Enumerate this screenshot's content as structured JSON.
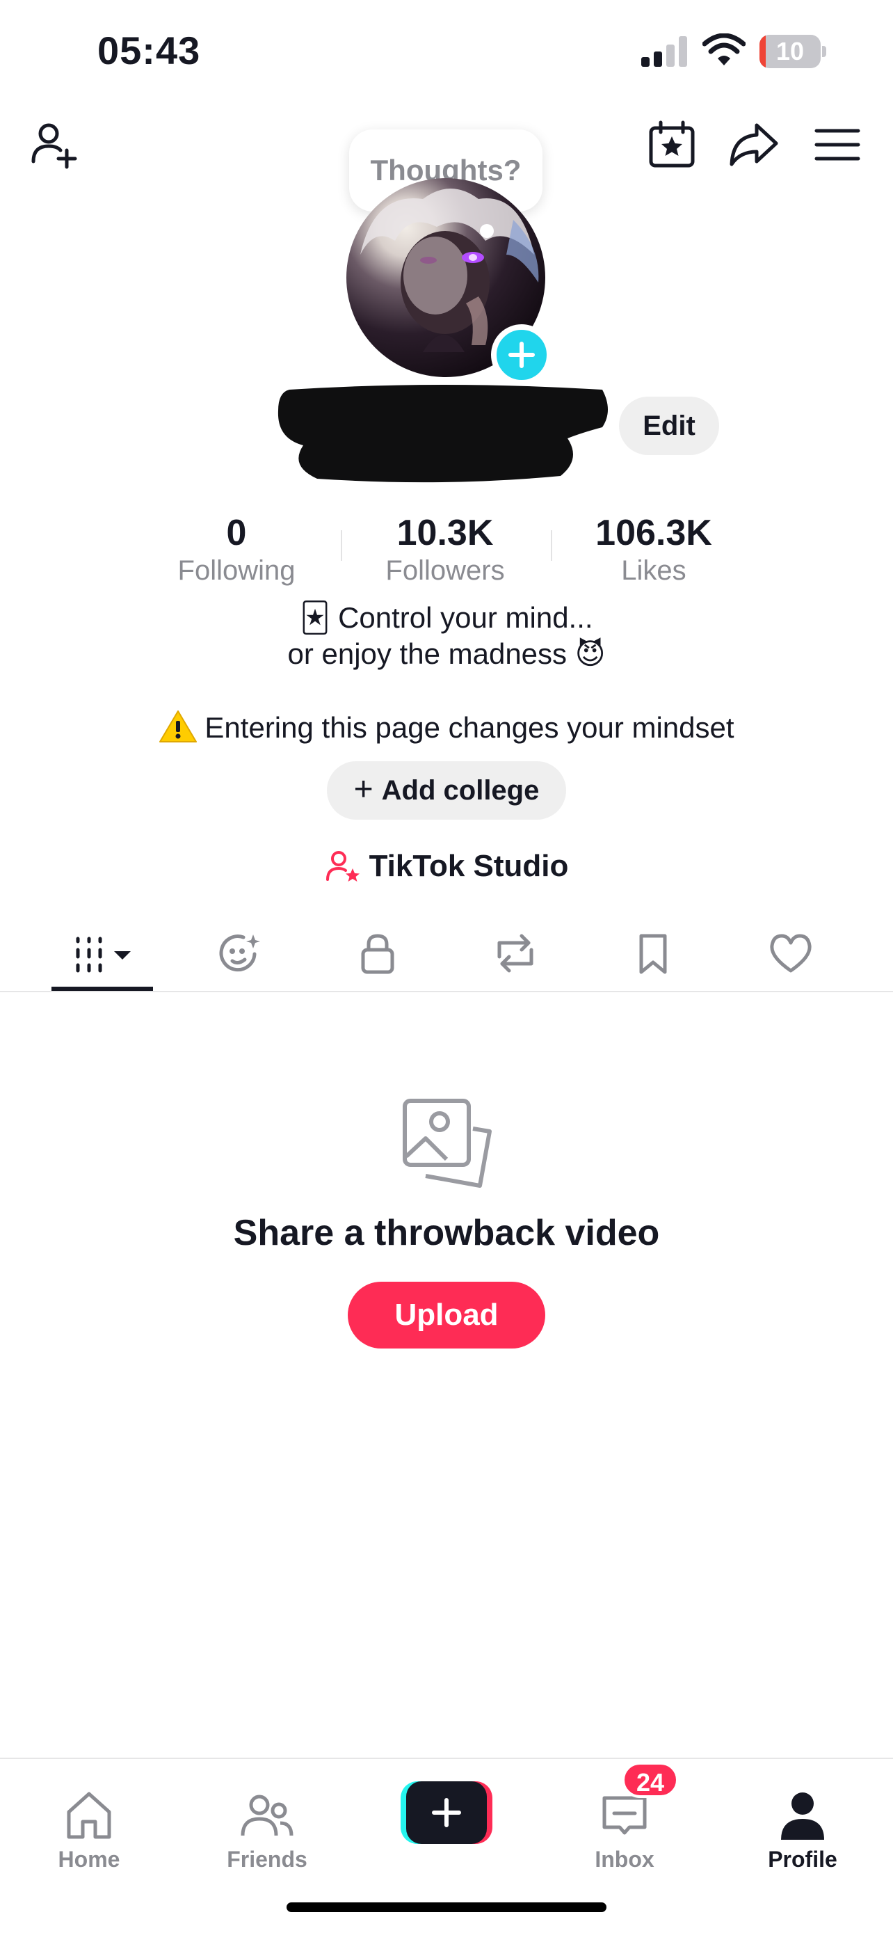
{
  "status_bar": {
    "time": "05:43",
    "battery_level": "10",
    "battery_fraction": 0.1,
    "battery_color": "#ef4436",
    "signal_icon": "cellular-signal-icon",
    "wifi_icon": "wifi-icon"
  },
  "header": {
    "add_friend_icon": "add-user-icon",
    "events_icon": "calendar-star-icon",
    "share_icon": "share-arrow-icon",
    "menu_icon": "hamburger-menu-icon"
  },
  "thoughts": {
    "label": "Thoughts?"
  },
  "profile": {
    "edit_label": "Edit",
    "stats": [
      {
        "value": "0",
        "label": "Following"
      },
      {
        "value": "10.3K",
        "label": "Followers"
      },
      {
        "value": "106.3K",
        "label": "Likes"
      }
    ],
    "bio": {
      "line1_emoji": "🃏",
      "line1_text": "Control your mind...",
      "line2_text": "or enjoy the madness",
      "line2_emoji": "😈",
      "warning_text": "Entering this page changes your mindset"
    },
    "add_college_label": "Add college",
    "studio_label": "TikTok Studio"
  },
  "tabs": [
    {
      "name": "videos",
      "icon": "grid-icon",
      "active": true
    },
    {
      "name": "for-you",
      "icon": "face-sparkle-icon"
    },
    {
      "name": "private",
      "icon": "lock-icon"
    },
    {
      "name": "reposts",
      "icon": "repost-icon"
    },
    {
      "name": "favorites",
      "icon": "bookmark-icon"
    },
    {
      "name": "liked",
      "icon": "heart-icon"
    }
  ],
  "empty_state": {
    "icon": "photo-stack-icon",
    "title": "Share a throwback video",
    "upload_label": "Upload"
  },
  "bottom_nav": {
    "items": [
      {
        "label": "Home",
        "icon": "home-icon"
      },
      {
        "label": "Friends",
        "icon": "friends-icon"
      },
      {
        "label": "",
        "icon": "create-plus-icon"
      },
      {
        "label": "Inbox",
        "icon": "inbox-icon"
      },
      {
        "label": "Profile",
        "icon": "profile-icon",
        "active": true
      }
    ],
    "inbox_badge": "24"
  },
  "colors": {
    "accent": "#fe2c55",
    "cyan": "#25f4ee",
    "text": "#161823",
    "secondary_text": "#8a8b91",
    "pill_bg": "#efefef"
  }
}
